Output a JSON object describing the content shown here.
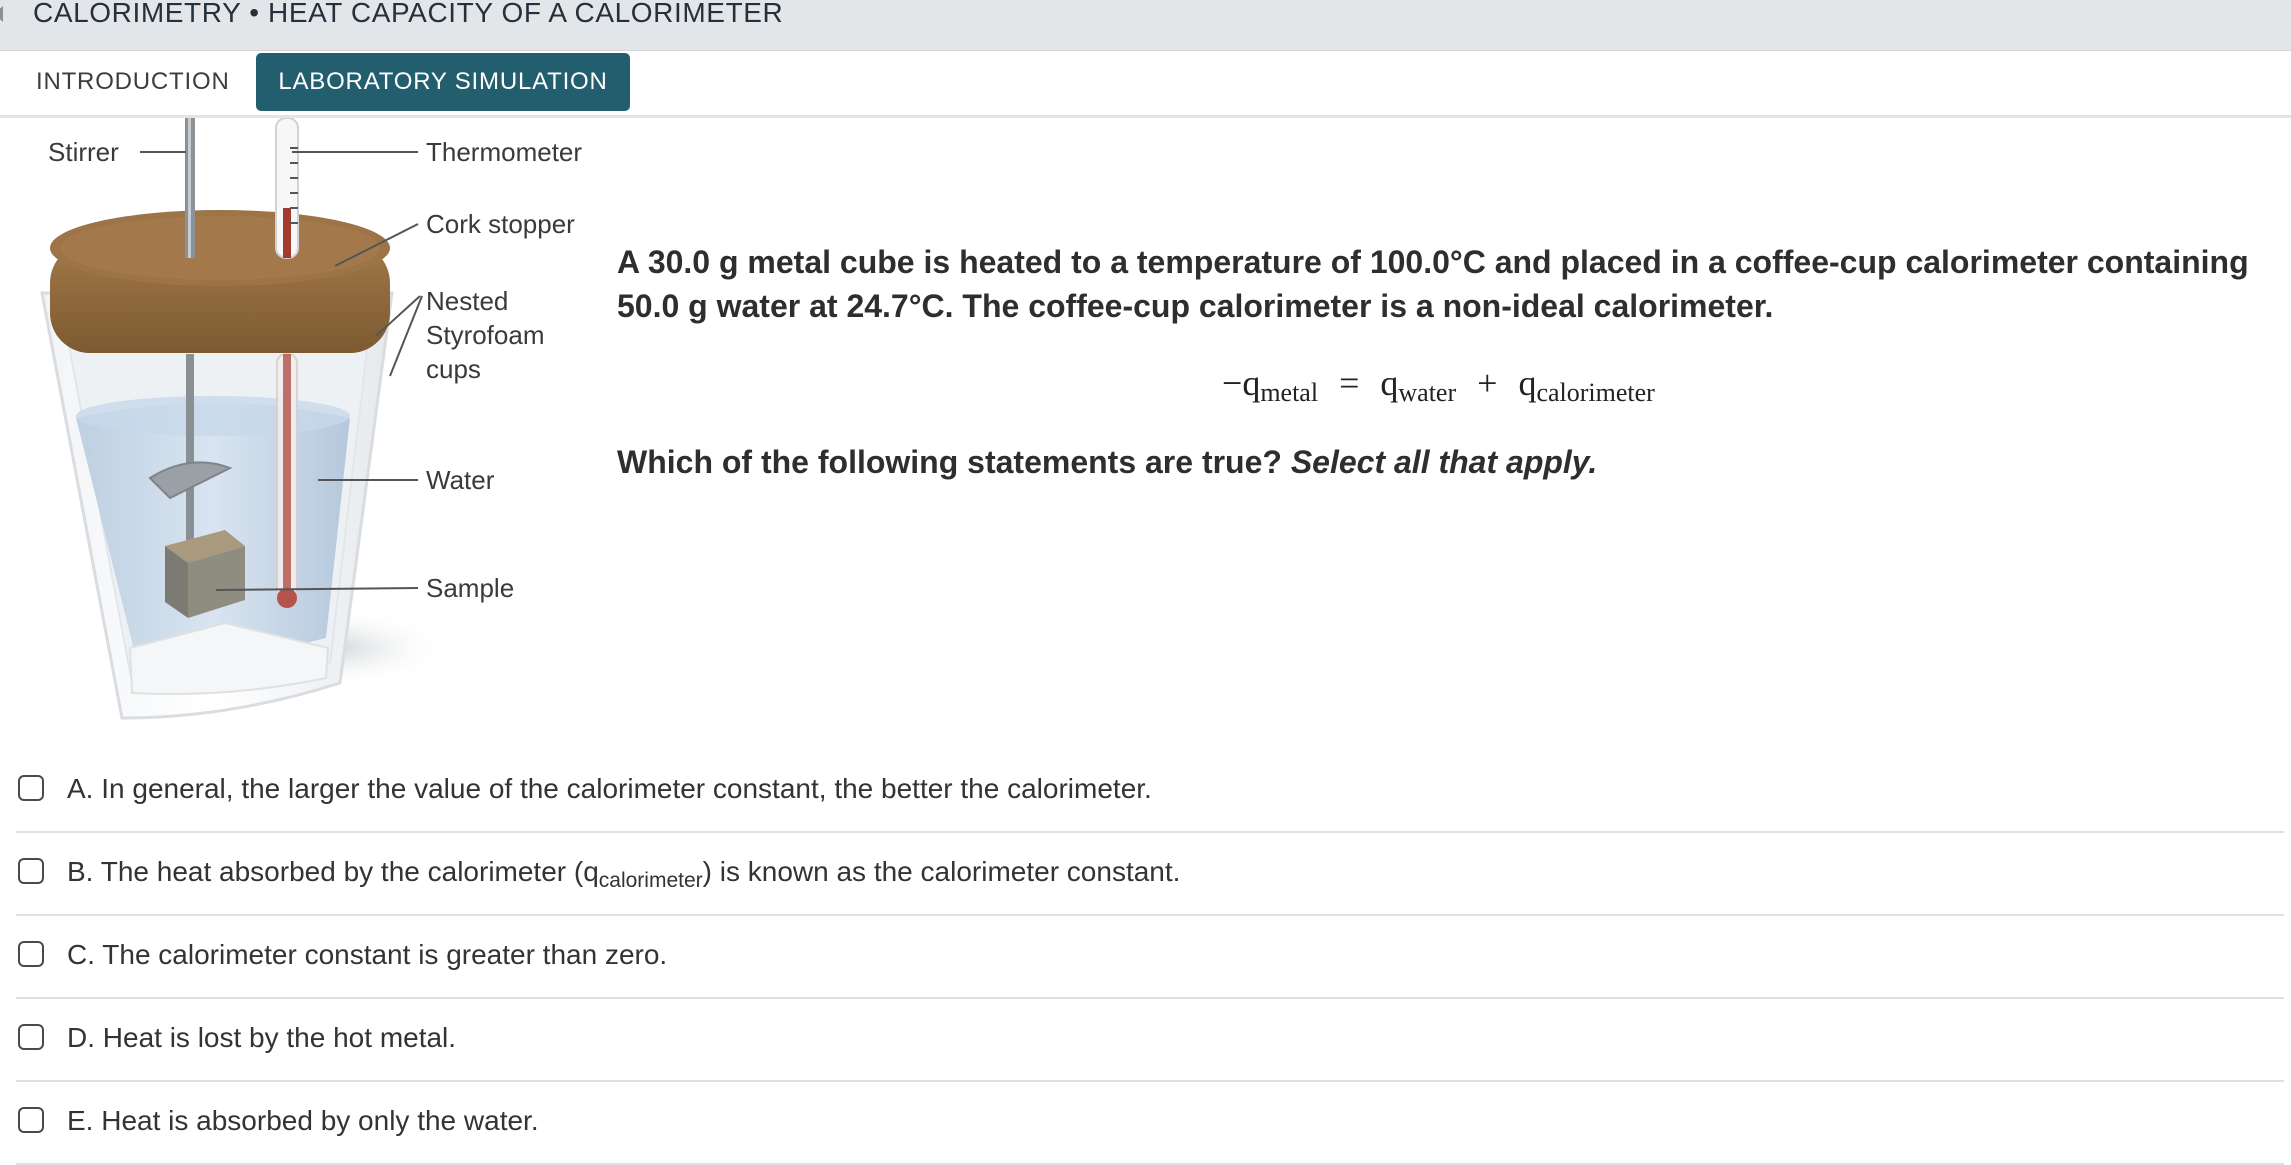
{
  "header": {
    "title": "CALORIMETRY • HEAT CAPACITY OF A CALORIMETER"
  },
  "tabs": [
    {
      "label": "INTRODUCTION",
      "active": false
    },
    {
      "label": "LABORATORY SIMULATION",
      "active": true
    }
  ],
  "colors": {
    "active_tab": "#235e6e",
    "header_bg": "#e3e6e8"
  },
  "figure": {
    "labels": {
      "stirrer": "Stirrer",
      "thermometer": "Thermometer",
      "cork_stopper": "Cork stopper",
      "nested_line1": "Nested",
      "nested_line2": "Styrofoam",
      "nested_line3": "cups",
      "water": "Water",
      "sample": "Sample"
    }
  },
  "question": {
    "text": "A 30.0 g metal cube is heated to a temperature of 100.0°C and placed in a coffee-cup calorimeter containing 50.0 g water at 24.7°C. The coffee-cup calorimeter is a non-ideal calorimeter.",
    "equation": {
      "minus": "−",
      "q1": "q",
      "q1_sub": "metal",
      "eq": "=",
      "q2": "q",
      "q2_sub": "water",
      "plus": "+",
      "q3": "q",
      "q3_sub": "calorimeter"
    },
    "prompt": "Which of the following statements are true?",
    "prompt_emphasis": "Select all that apply."
  },
  "options": [
    {
      "text": "A. In general, the larger the value of the calorimeter constant, the better the calorimeter.",
      "checked": false
    },
    {
      "text_before": "B. The heat absorbed by the calorimeter (q",
      "sub": "calorimeter",
      "text_after": ") is known as the calorimeter constant.",
      "checked": false
    },
    {
      "text": "C. The calorimeter constant is greater than zero.",
      "checked": false
    },
    {
      "text": "D. Heat is lost by the hot metal.",
      "checked": false
    },
    {
      "text": "E. Heat is absorbed by only the water.",
      "checked": false
    }
  ]
}
